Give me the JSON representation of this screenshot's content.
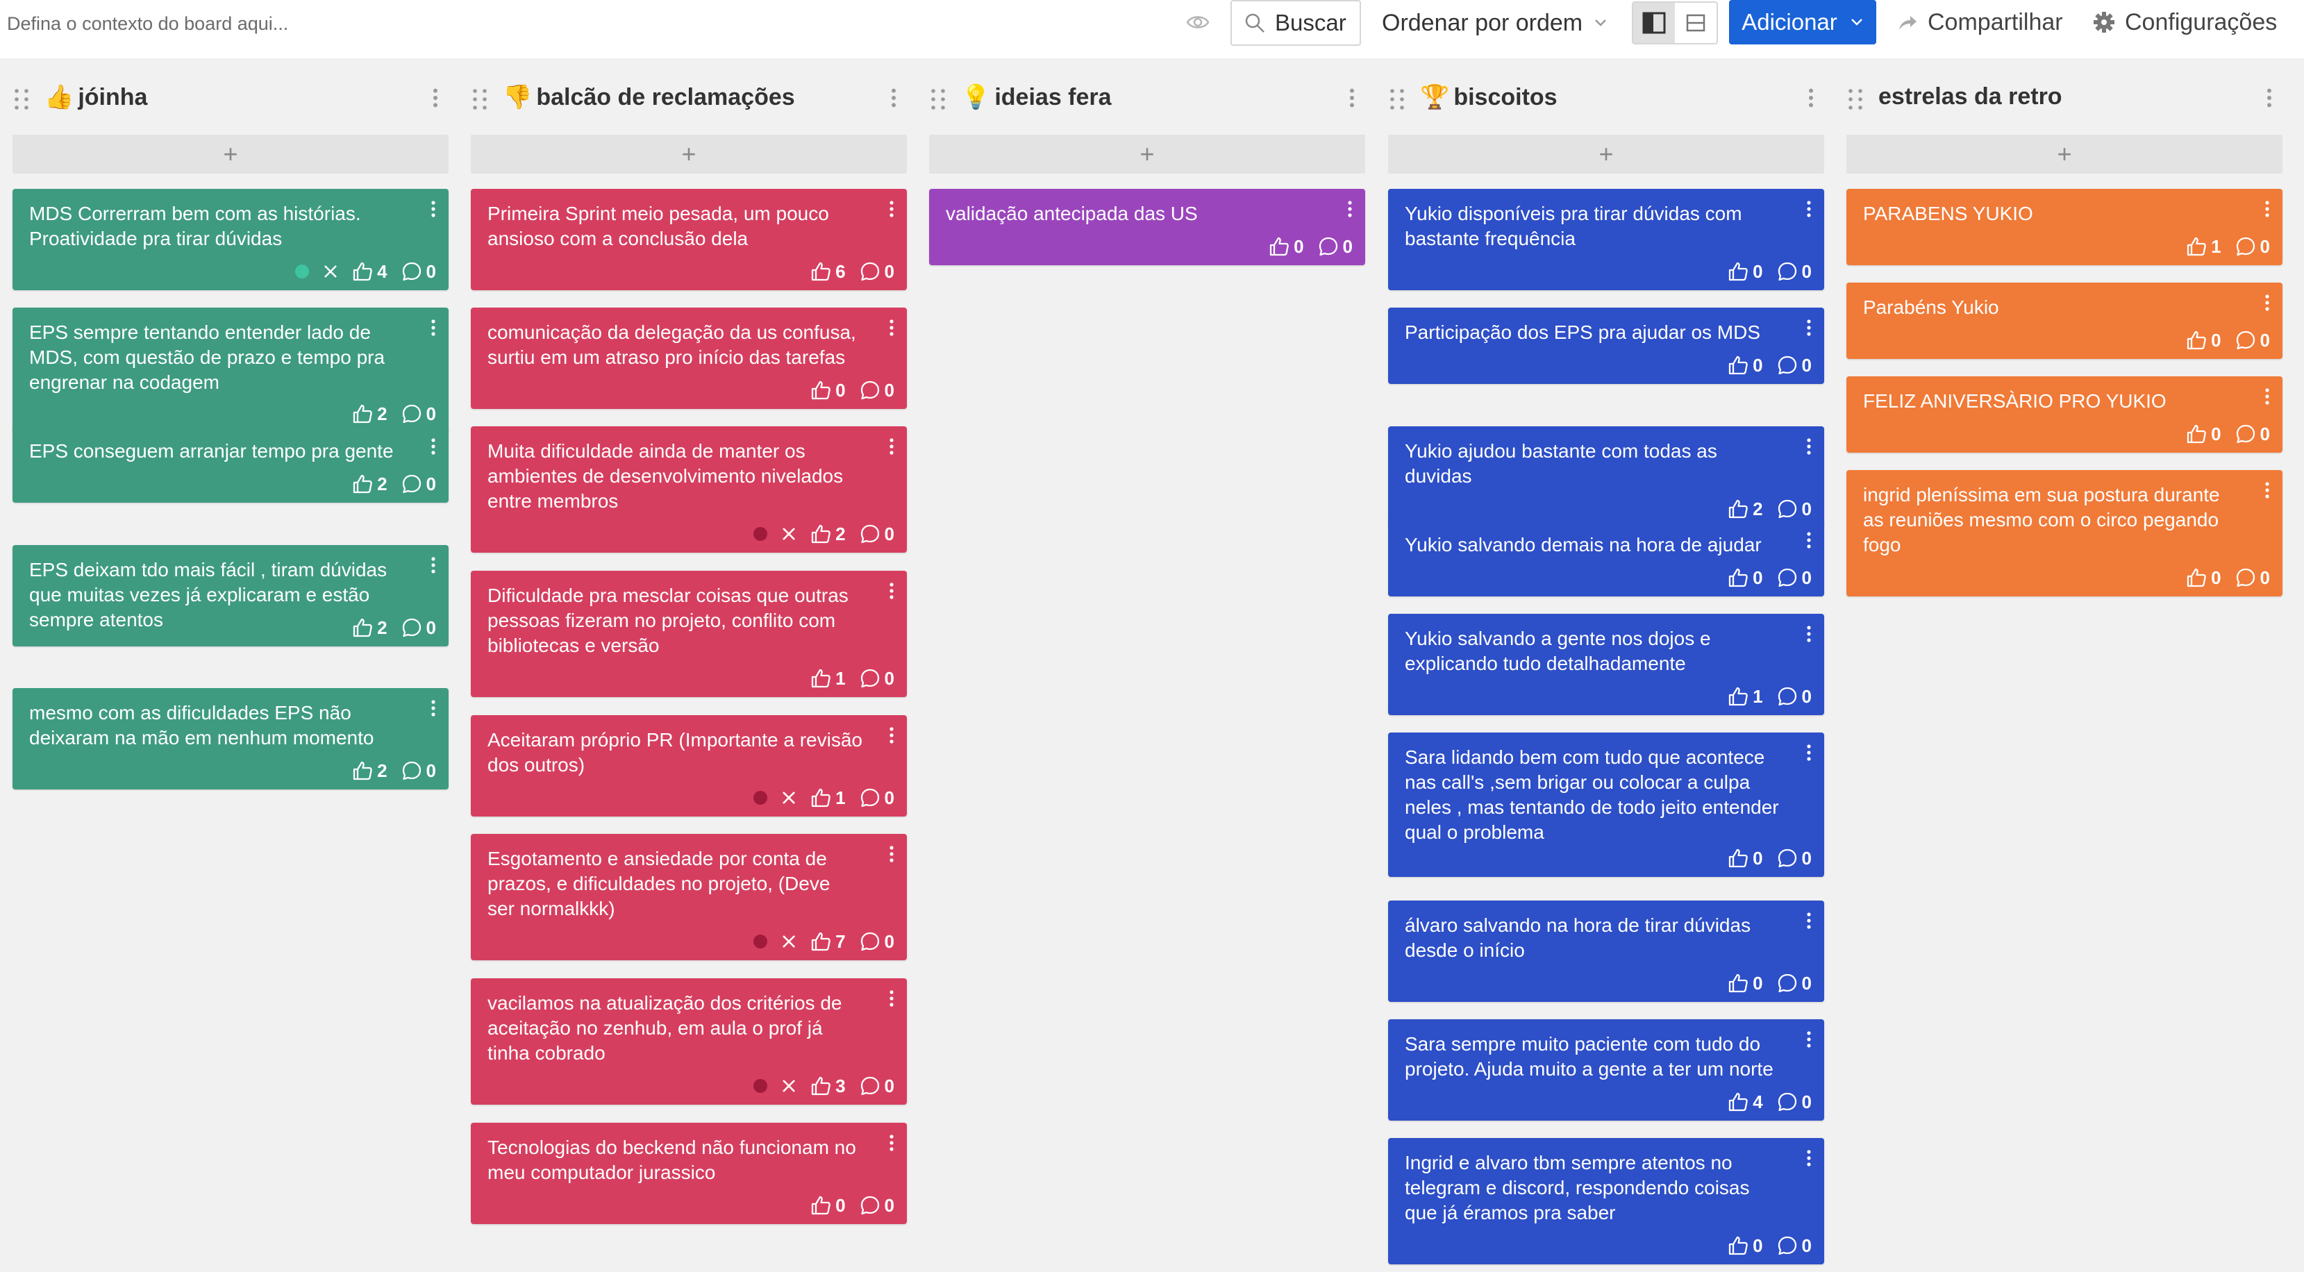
{
  "topbar": {
    "context_placeholder": "Defina o contexto do board aqui...",
    "search_label": "Buscar",
    "sort_label": "Ordenar por ordem",
    "add_label": "Adicionar",
    "share_label": "Compartilhar",
    "settings_label": "Configurações"
  },
  "add_symbol": "+",
  "columns": [
    {
      "emoji": "👍",
      "title": "jóinha",
      "color": "#3e9b80",
      "cards": [
        {
          "text": "MDS Correrram bem com as histórias. Proatividade pra tirar dúvidas",
          "likes": "4",
          "comments": "0",
          "status_dot": "#3fc4a0"
        },
        {
          "text": "EPS sempre tentando entender lado de MDS, com questão de prazo e tempo pra engrenar na codagem",
          "likes": "2",
          "comments": "0"
        },
        {
          "text": "EPS conseguem arranjar tempo pra gente",
          "likes": "2",
          "comments": "0"
        },
        {
          "text": "EPS deixam tdo mais fácil , tiram dúvidas que muitas vezes já explicaram e estão sempre atentos",
          "likes": "2",
          "comments": "0"
        },
        {
          "text": "mesmo com as dificuldades EPS não deixaram na mão em nenhum momento",
          "likes": "2",
          "comments": "0"
        }
      ]
    },
    {
      "emoji": "👎",
      "title": "balcão de reclamações",
      "color": "#d63e5f",
      "cards": [
        {
          "text": "Primeira Sprint meio pesada, um pouco ansioso com a conclusão dela",
          "likes": "6",
          "comments": "0"
        },
        {
          "text": "comunicação da delegação da us confusa, surtiu em um atraso pro início das tarefas",
          "likes": "0",
          "comments": "0"
        },
        {
          "text": "Muita dificuldade ainda de manter os ambientes de desenvolvimento nivelados entre membros",
          "likes": "2",
          "comments": "0",
          "status_dot": "#a01a3a"
        },
        {
          "text": "Dificuldade pra mesclar coisas que outras pessoas fizeram no projeto, conflito com bibliotecas e versão",
          "likes": "1",
          "comments": "0"
        },
        {
          "text": "Aceitaram próprio PR (Importante a revisão dos outros)",
          "likes": "1",
          "comments": "0",
          "status_dot": "#a01a3a"
        },
        {
          "text": "Esgotamento e ansiedade por conta de prazos, e dificuldades no projeto, (Deve ser normalkkk)",
          "likes": "7",
          "comments": "0",
          "status_dot": "#a01a3a"
        },
        {
          "text": "vacilamos na atualização dos critérios de aceitação no zenhub, em aula o prof já tinha cobrado",
          "likes": "3",
          "comments": "0",
          "status_dot": "#a01a3a"
        },
        {
          "text": "Tecnologias do beckend não funcionam no meu computador jurassico",
          "likes": "0",
          "comments": "0"
        }
      ]
    },
    {
      "emoji": "💡",
      "title": "ideias fera",
      "color": "#9b45bd",
      "cards": [
        {
          "text": "validação antecipada das US",
          "likes": "0",
          "comments": "0"
        }
      ]
    },
    {
      "emoji": "🏆",
      "title": "biscoitos",
      "color": "#2d4fc7",
      "cards": [
        {
          "text": "Yukio disponíveis pra tirar dúvidas com bastante frequência",
          "likes": "0",
          "comments": "0"
        },
        {
          "text": "Participação dos EPS pra ajudar os MDS",
          "likes": "0",
          "comments": "0"
        },
        {
          "text": "Yukio ajudou bastante com todas as duvidas",
          "likes": "2",
          "comments": "0"
        },
        {
          "text": "Yukio salvando demais na hora de ajudar",
          "likes": "0",
          "comments": "0"
        },
        {
          "text": "Yukio salvando a gente nos dojos e explicando tudo detalhadamente",
          "likes": "1",
          "comments": "0"
        },
        {
          "text": "Sara lidando bem com tudo que acontece nas call's ,sem brigar ou colocar a culpa neles , mas tentando de todo jeito entender qual o problema",
          "likes": "0",
          "comments": "0"
        },
        {
          "text": "álvaro salvando na hora de tirar dúvidas desde o início",
          "likes": "0",
          "comments": "0"
        },
        {
          "text": "Sara sempre muito paciente com tudo do projeto. Ajuda muito a gente a ter um norte",
          "likes": "4",
          "comments": "0"
        },
        {
          "text": "Ingrid e alvaro tbm sempre atentos no telegram e discord, respondendo coisas que já éramos pra saber",
          "likes": "0",
          "comments": "0"
        }
      ]
    },
    {
      "emoji": "",
      "title": "estrelas da retro",
      "color": "#f07a38",
      "cards": [
        {
          "text": "PARABENS YUKIO",
          "likes": "1",
          "comments": "0"
        },
        {
          "text": "Parabéns Yukio",
          "likes": "0",
          "comments": "0"
        },
        {
          "text": "FELIZ ANIVERSÀRIO PRO YUKIO",
          "likes": "0",
          "comments": "0"
        },
        {
          "text": "ingrid pleníssima em sua postura durante as reuniões mesmo com o circo pegando fogo",
          "likes": "0",
          "comments": "0"
        }
      ]
    }
  ]
}
